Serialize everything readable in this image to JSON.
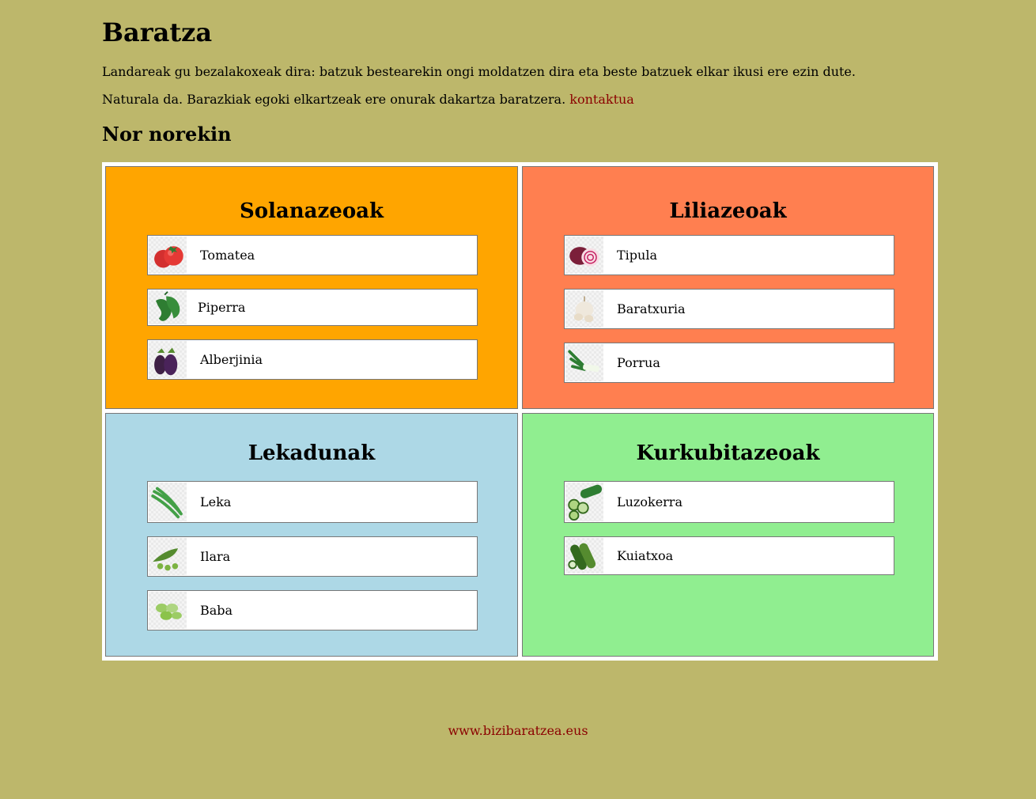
{
  "header": {
    "title": "Baratza",
    "intro_line1": "Landareak gu bezalakoxeak dira: batzuk bestearekin ongi moldatzen dira eta beste batzuek elkar ikusi ere ezin dute.",
    "intro_line2": "Naturala da. Barazkiak egoki elkartzeak ere onurak dakartza baratzera.",
    "contact_link": "kontaktua",
    "section_title": "Nor norekin"
  },
  "groups": [
    {
      "name": "Solanazeoak",
      "color": "#ffa500",
      "items": [
        {
          "label": "Tomatea",
          "icon": "tomato-icon"
        },
        {
          "label": "Piperra",
          "icon": "pepper-icon"
        },
        {
          "label": "Alberjinia",
          "icon": "eggplant-icon"
        }
      ]
    },
    {
      "name": "Liliazeoak",
      "color": "#ff7f50",
      "items": [
        {
          "label": "Tipula",
          "icon": "onion-icon"
        },
        {
          "label": "Baratxuria",
          "icon": "garlic-icon"
        },
        {
          "label": "Porrua",
          "icon": "leek-icon"
        }
      ]
    },
    {
      "name": "Lekadunak",
      "color": "#add8e6",
      "items": [
        {
          "label": "Leka",
          "icon": "green-bean-icon"
        },
        {
          "label": "Ilara",
          "icon": "pea-icon"
        },
        {
          "label": "Baba",
          "icon": "broad-bean-icon"
        }
      ]
    },
    {
      "name": "Kurkubitazeoak",
      "color": "#90ee90",
      "items": [
        {
          "label": "Luzokerra",
          "icon": "cucumber-icon"
        },
        {
          "label": "Kuiatxoa",
          "icon": "zucchini-icon"
        }
      ]
    }
  ],
  "footer": {
    "link": "www.bizibaratzea.eus",
    "link_color": "#8b0000"
  }
}
